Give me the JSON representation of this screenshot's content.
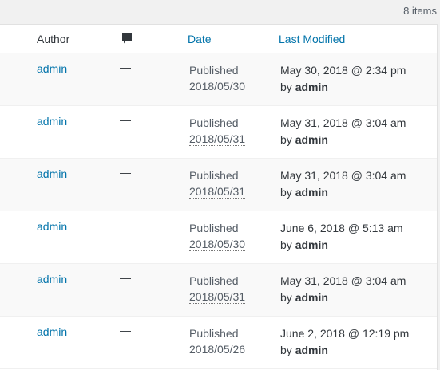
{
  "items_count": "8 items",
  "columns": {
    "author": "Author",
    "comments_icon": "comment-bubble",
    "date": "Date",
    "last_modified": "Last Modified"
  },
  "rows": [
    {
      "author": "admin",
      "comments": "—",
      "status": "Published",
      "date": "2018/05/30",
      "modified": "May 30, 2018 @ 2:34 pm",
      "by": "by",
      "modified_by": "admin"
    },
    {
      "author": "admin",
      "comments": "—",
      "status": "Published",
      "date": "2018/05/31",
      "modified": "May 31, 2018 @ 3:04 am",
      "by": "by",
      "modified_by": "admin"
    },
    {
      "author": "admin",
      "comments": "—",
      "status": "Published",
      "date": "2018/05/31",
      "modified": "May 31, 2018 @ 3:04 am",
      "by": "by",
      "modified_by": "admin"
    },
    {
      "author": "admin",
      "comments": "—",
      "status": "Published",
      "date": "2018/05/30",
      "modified": "June 6, 2018 @ 5:13 am",
      "by": "by",
      "modified_by": "admin"
    },
    {
      "author": "admin",
      "comments": "—",
      "status": "Published",
      "date": "2018/05/31",
      "modified": "May 31, 2018 @ 3:04 am",
      "by": "by",
      "modified_by": "admin"
    },
    {
      "author": "admin",
      "comments": "—",
      "status": "Published",
      "date": "2018/05/26",
      "modified": "June 2, 2018 @ 12:19 pm",
      "by": "by",
      "modified_by": "admin"
    }
  ],
  "colors": {
    "link": "#0073aa",
    "text": "#555d66",
    "dark_text": "#32373c",
    "row_alt": "#f9f9f9"
  }
}
